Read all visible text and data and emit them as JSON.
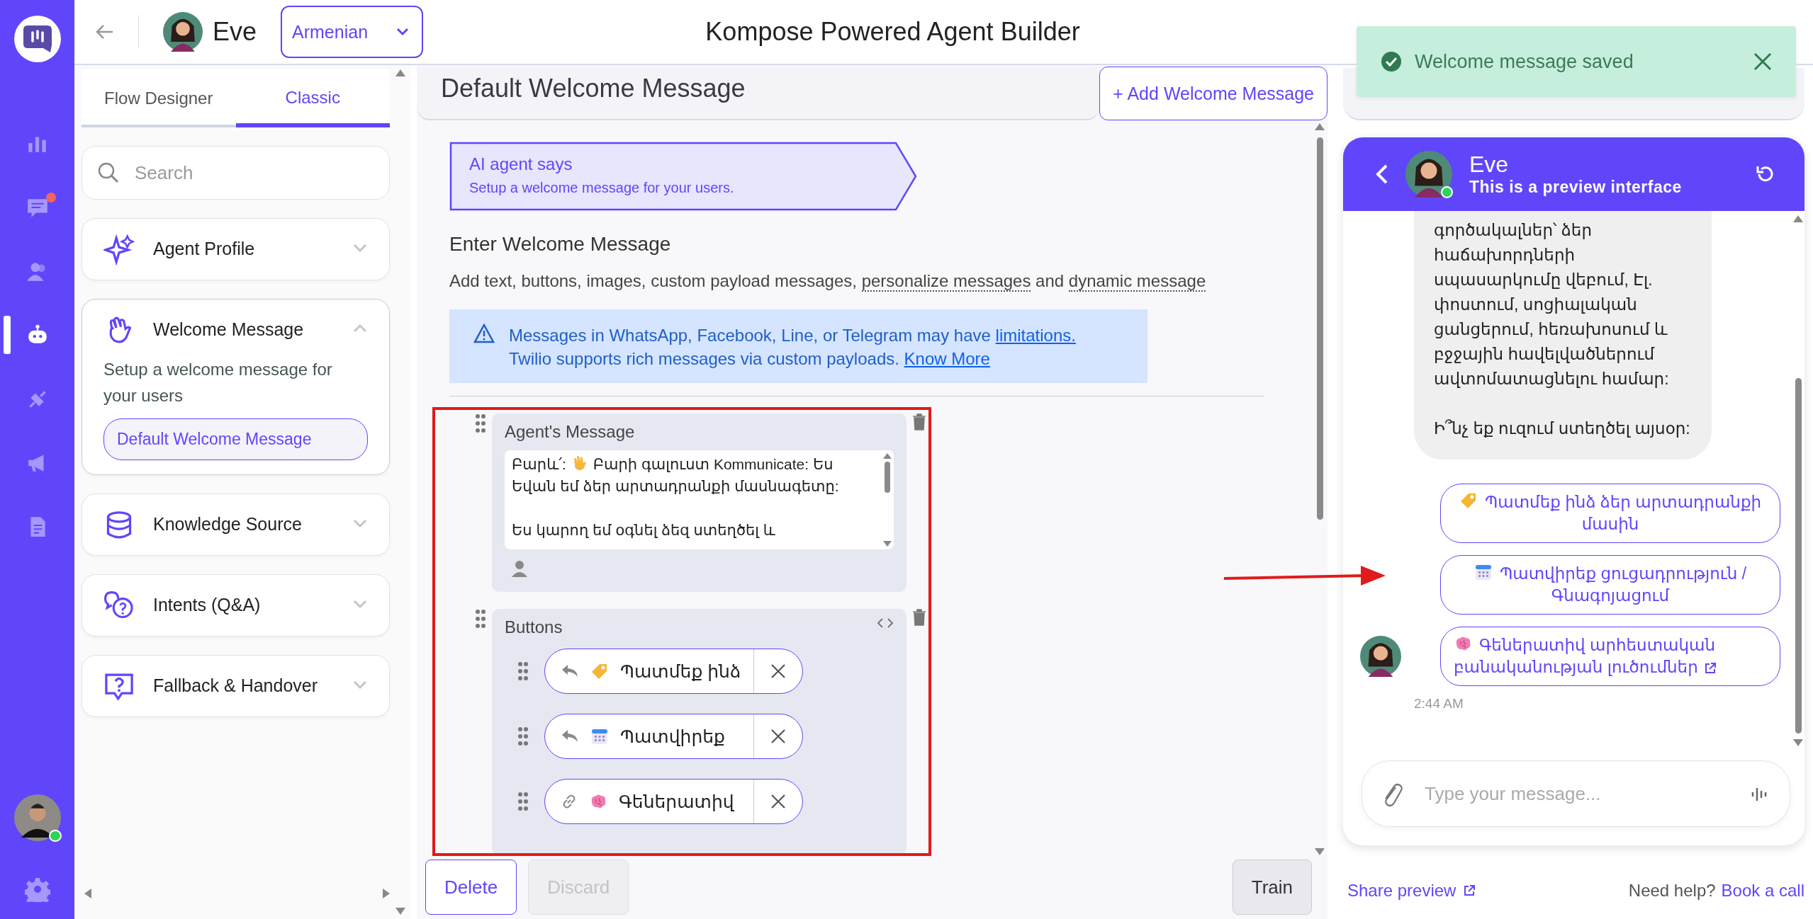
{
  "rail": {
    "items": [
      {
        "selected": false,
        "notification": false
      },
      {
        "selected": false,
        "notification": true
      },
      {
        "selected": false,
        "notification": false
      },
      {
        "selected": true,
        "notification": false
      },
      {
        "selected": false,
        "notification": false
      },
      {
        "selected": false,
        "notification": false
      },
      {
        "selected": false,
        "notification": false
      }
    ],
    "user_online": true
  },
  "top_bar": {
    "agent_name": "Eve",
    "language": "Armenian",
    "title": "Kompose Powered Agent Builder"
  },
  "tabs": [
    {
      "label": "Flow Designer",
      "selected": false
    },
    {
      "label": "Classic",
      "selected": true
    }
  ],
  "search": {
    "placeholder": "Search"
  },
  "sections": [
    {
      "title": "Agent Profile",
      "expanded": false
    },
    {
      "title": "Welcome Message",
      "expanded": true,
      "description": "Setup a welcome message for your users",
      "items": [
        {
          "label": "Default Welcome Message",
          "selected": true
        }
      ]
    },
    {
      "title": "Knowledge Source",
      "expanded": false
    },
    {
      "title": "Intents (Q&A)",
      "expanded": false
    },
    {
      "title": "Fallback & Handover",
      "expanded": false
    }
  ],
  "editor": {
    "title": "Default Welcome Message",
    "add_button": "+ Add Welcome Message",
    "banner": {
      "title": "AI agent says",
      "subtitle": "Setup a welcome message for your users."
    },
    "heading": "Enter Welcome Message",
    "description": [
      {
        "kind": "plain",
        "text": "Add text, buttons, images, custom payload messages, "
      },
      {
        "kind": "hint",
        "text": "personalize messages"
      },
      {
        "kind": "plain",
        "text": " and "
      },
      {
        "kind": "hint",
        "text": "dynamic message"
      }
    ],
    "notice": [
      {
        "kind": "plain",
        "text": "Messages in WhatsApp, Facebook, Line, or Telegram may have "
      },
      {
        "kind": "link",
        "text": "limitations."
      },
      {
        "kind": "break",
        "text": "Twilio supports rich messages via custom payloads. "
      },
      {
        "kind": "link",
        "text": "Know More"
      }
    ],
    "blocks": [
      {
        "kind": "text",
        "title": "Agent's Message",
        "greeting": "Բարև՛:",
        "message": "Բարի գալուստ Kommunicate: Ես Եվան եմ ձեր արտադրանքի մասնագետը:\n\nԵս կարող եմ օգնել ձեզ ստեղծել և"
      },
      {
        "kind": "buttons",
        "title": "Buttons",
        "buttons": [
          {
            "kind": "reply",
            "label": "Պատմեք ինձ"
          },
          {
            "kind": "reply",
            "label": "Պատվիրեք"
          },
          {
            "kind": "link",
            "label": "Գեներատիվ"
          }
        ]
      }
    ],
    "actions": [
      {
        "kind": "delete",
        "label": "Delete",
        "disabled": false
      },
      {
        "kind": "discard",
        "label": "Discard",
        "disabled": true
      },
      {
        "kind": "train",
        "label": "Train",
        "disabled": false
      }
    ]
  },
  "toast": {
    "message": "Welcome message saved"
  },
  "chat": {
    "name": "Eve",
    "subtitle": "This is a preview interface",
    "online": true,
    "bubble": "գործակալներ՝ ձեր\nհաճախորդների\nսպասարկումը վեբում, Էլ.\nփոստում, սոցիալական\nցանցերում, հեռախոսում և\nբջջային հավելվածներում\nավտոմատացնելու համար:\n\nԻ՞նչ եք ուզում ստեղծել այսօր:",
    "quick_replies": [
      {
        "kind": "reply",
        "label": "Պատմեք ինձ ձեր արտադրանքի մասին"
      },
      {
        "kind": "reply",
        "label": "Պատվիրեք ցուցադրություն / Գնագոյացում"
      },
      {
        "kind": "link",
        "label": "Գեներատիվ արհեստական բանականության լուծումներ"
      }
    ],
    "time": "2:44 AM",
    "input": {
      "placeholder": "Type your message..."
    }
  },
  "footer": {
    "share": "Share preview",
    "help": "Need help?",
    "book": "Book a call"
  }
}
